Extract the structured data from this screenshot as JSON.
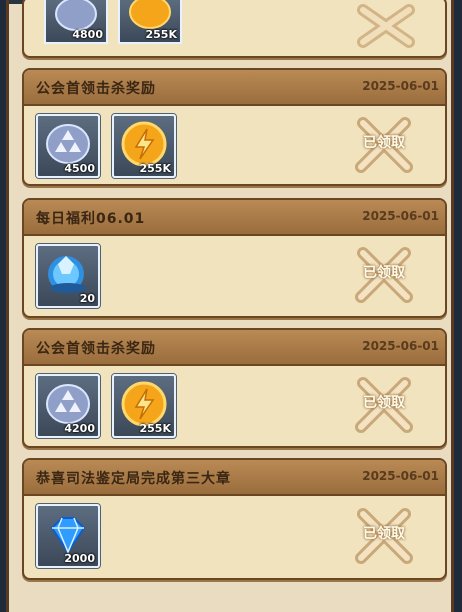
{
  "cards": [
    {
      "items": [
        {
          "icon": "silver-badge-icon",
          "qty": "4800"
        },
        {
          "icon": "gold-coin-icon",
          "qty": "255K"
        }
      ]
    },
    {
      "title": "公会首领击杀奖励",
      "date": "2025-06-01",
      "status": "已领取",
      "items": [
        {
          "icon": "silver-badge-icon",
          "qty": "4500"
        },
        {
          "icon": "gold-coin-icon",
          "qty": "255K"
        }
      ]
    },
    {
      "title": "每日福利06.01",
      "date": "2025-06-01",
      "status": "已领取",
      "items": [
        {
          "icon": "crystal-orb-icon",
          "qty": "20"
        }
      ]
    },
    {
      "title": "公会首领击杀奖励",
      "date": "2025-06-01",
      "status": "已领取",
      "items": [
        {
          "icon": "silver-badge-icon",
          "qty": "4200"
        },
        {
          "icon": "gold-coin-icon",
          "qty": "255K"
        }
      ]
    },
    {
      "title": "恭喜司法鉴定局完成第三大章",
      "date": "2025-06-01",
      "status": "已领取",
      "items": [
        {
          "icon": "blue-diamond-icon",
          "qty": "2000"
        }
      ]
    }
  ]
}
